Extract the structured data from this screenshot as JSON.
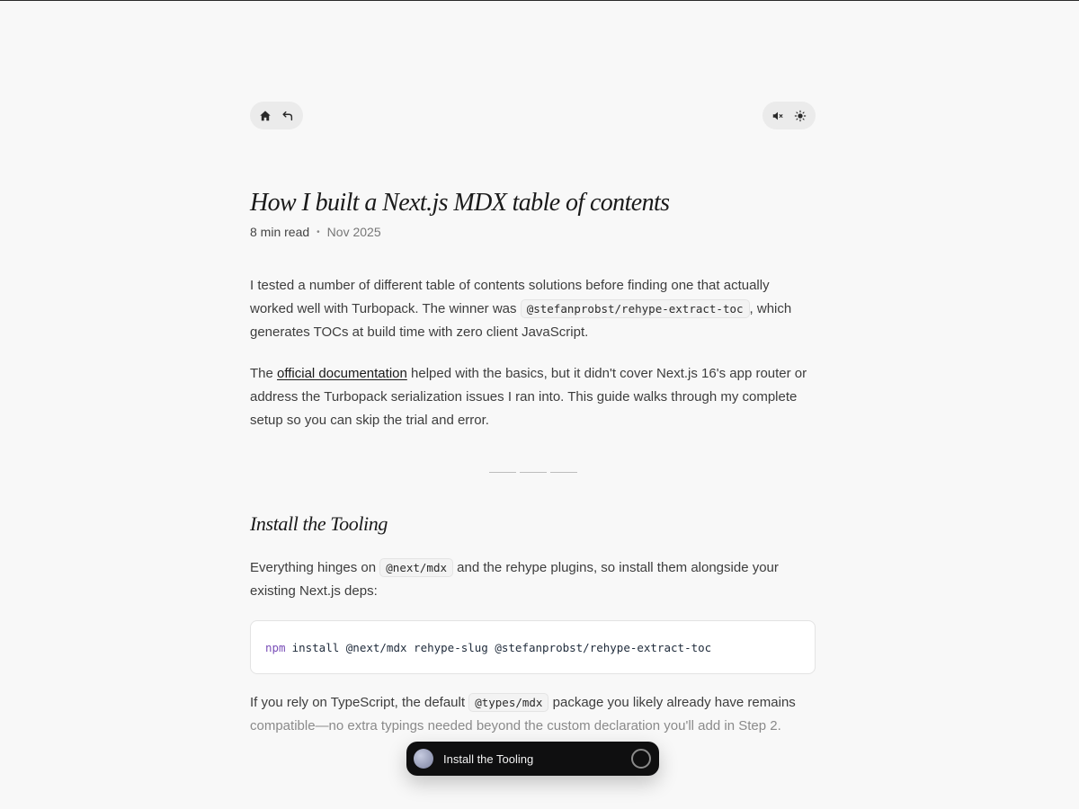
{
  "nav": {
    "home_icon": "home-icon",
    "back_icon": "back-arrow-icon",
    "mute_icon": "speaker-muted-icon",
    "theme_icon": "sun-icon"
  },
  "article": {
    "title": "How I built a Next.js MDX table of contents",
    "read_time": "8 min read",
    "separator": "•",
    "date": "Nov 2025",
    "p1": {
      "before": "I tested a number of different table of contents solutions before finding one that actually worked well with Turbopack. The winner was ",
      "code": "@stefanprobst/rehype-extract-toc",
      "after": ", which generates TOCs at build time with zero client JavaScript."
    },
    "p2": {
      "before": "The ",
      "link": "official documentation",
      "after": " helped with the basics, but it didn't cover Next.js 16's app router or address the Turbopack serialization issues I ran into. This guide walks through my complete setup so you can skip the trial and error."
    },
    "section_title": "Install the Tooling",
    "p3": {
      "before": "Everything hinges on ",
      "code": "@next/mdx",
      "after": " and the rehype plugins, so install them alongside your existing Next.js deps:"
    },
    "codeblock": {
      "cmd": "npm",
      "rest": "install @next/mdx rehype-slug @stefanprobst/rehype-extract-toc"
    },
    "p4": {
      "before": "If you rely on TypeScript, the default ",
      "code": "@types/mdx",
      "after_1": " package you likely already have remains",
      "after_2": "compatible—no extra typings needed beyond the custom declaration you'll add in Step 2."
    }
  },
  "toc_bar": {
    "label": "Install the Tooling"
  }
}
